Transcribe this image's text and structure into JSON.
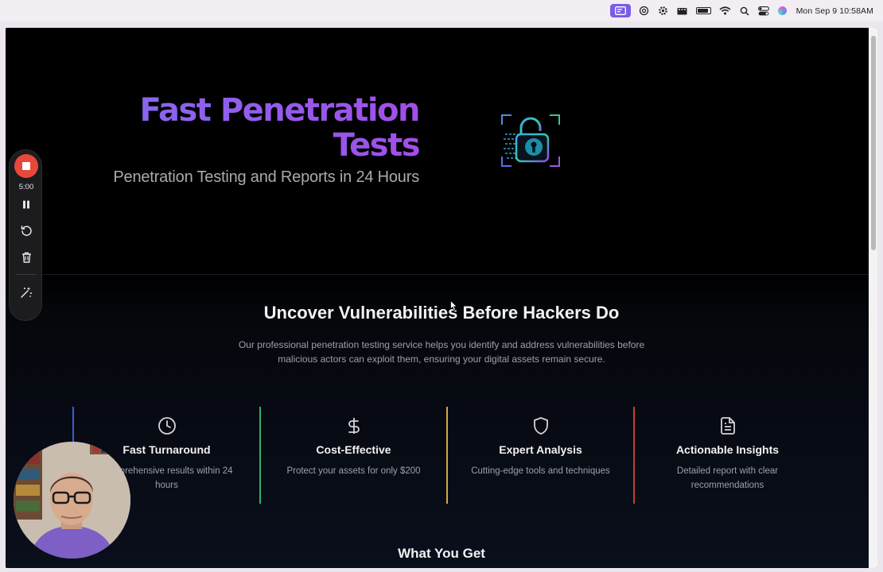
{
  "menubar": {
    "apple_glyph": "",
    "clock": "Mon Sep 9  10:58AM"
  },
  "recorder": {
    "time": "5:00"
  },
  "hero": {
    "title_line1": "Fast Penetration",
    "title_line2": "Tests",
    "subtitle": "Penetration Testing and Reports in 24 Hours"
  },
  "section": {
    "title": "Uncover Vulnerabilities Before Hackers Do",
    "description": "Our professional penetration testing service helps you identify and address vulnerabilities before malicious actors can exploit them, ensuring your digital assets remain secure."
  },
  "features": [
    {
      "icon": "clock-icon",
      "title": "Fast Turnaround",
      "description": "Comprehensive results within 24 hours",
      "accent": "#3b5bdb"
    },
    {
      "icon": "dollar-icon",
      "title": "Cost-Effective",
      "description": "Protect your assets for only $200",
      "accent": "#2fb36b"
    },
    {
      "icon": "shield-icon",
      "title": "Expert Analysis",
      "description": "Cutting-edge tools and techniques",
      "accent": "#d9a441"
    },
    {
      "icon": "document-icon",
      "title": "Actionable Insights",
      "description": "Detailed report with clear recommendations",
      "accent": "#c53b3b"
    }
  ],
  "bottom": {
    "title": "What You Get"
  },
  "colors": {
    "title_gradient_start": "#7f6ff0",
    "title_gradient_end": "#a04fe8",
    "record_red": "#e8473b"
  }
}
